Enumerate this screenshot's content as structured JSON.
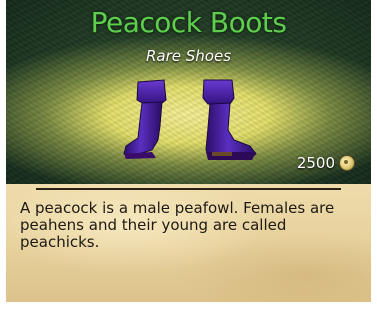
{
  "item": {
    "name": "Peacock Boots",
    "rarity": "Rare Shoes",
    "price": "2500",
    "currency_icon": "coin-icon",
    "description": "A peacock is a male peafowl. Females are peahens and their young are called peachicks."
  },
  "colors": {
    "title": "#5fce4e",
    "boot": "#4a1fa0",
    "panel": "#1c3521",
    "parchment": "#e7d19c"
  }
}
